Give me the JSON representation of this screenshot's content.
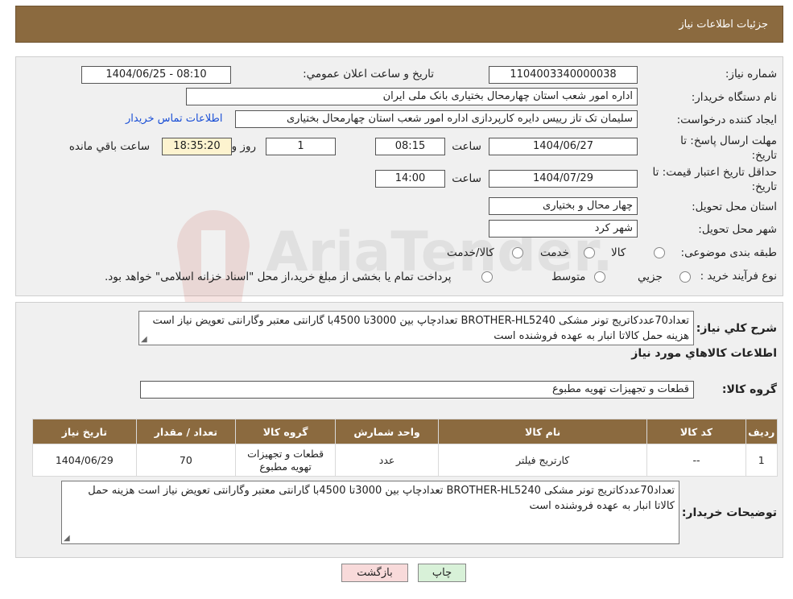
{
  "header": {
    "title": "جزئیات اطلاعات نیاز"
  },
  "form": {
    "need_number": {
      "label": "شماره نیاز:",
      "value": "1104003340000038"
    },
    "announce_datetime": {
      "label": "تاریخ و ساعت اعلان عمومي:",
      "value": "1404/06/25 - 08:10"
    },
    "buyer_org": {
      "label": "نام دستگاه خريدار:",
      "value": "اداره امور شعب استان چهارمحال بختیاری بانک ملی ایران"
    },
    "requester": {
      "label": "ايجاد كننده درخواست:",
      "value": "سلیمان تک تاز رییس دایره کارپردازی  اداره امور شعب استان چهارمحال بختیاری",
      "contact_link": "اطلاعات تماس خريدار"
    },
    "deadline": {
      "label": "مهلت ارسال پاسخ: تا تاريخ:",
      "date": "1404/06/27",
      "time_label": "ساعت",
      "time": "08:15",
      "days": "1",
      "days_label": "روز و",
      "remaining": "18:35:20",
      "remaining_label": "ساعت باقي مانده"
    },
    "price_validity": {
      "label": "حداقل تاريخ اعتبار قيمت: تا تاريخ:",
      "date": "1404/07/29",
      "time_label": "ساعت",
      "time": "14:00"
    },
    "delivery_province": {
      "label": "استان محل تحويل:",
      "value": "چهار محال و بختیاری"
    },
    "delivery_city": {
      "label": "شهر محل تحويل:",
      "value": "شهر کرد"
    },
    "category": {
      "label": "طبقه بندی موضوعی:",
      "options": [
        "کالا",
        "خدمت",
        "کالا/خدمت"
      ]
    },
    "purchase_type": {
      "label": "نوع فرآيند خريد :",
      "options": [
        "جزيي",
        "متوسط"
      ],
      "note": "پرداخت تمام یا بخشی از مبلغ خرید،از محل \"اسناد خزانه اسلامی\" خواهد بود."
    }
  },
  "summary": {
    "label": "شرح كلي نياز:",
    "text": "تعداد70عددکاتریج تونر مشکی BROTHER-HL5240 تعدادچاپ بین 3000تا 4500با گارانتی معتبر وگارانتی تعویض نیاز است هزینه حمل کالاتا انبار به عهده فروشنده است",
    "goods_info_title": "اطلاعات كالاهاي مورد نياز",
    "goods_group_label": "گروه كالا:",
    "goods_group_value": "قطعات و تجهیزات تهویه مطبوع"
  },
  "table": {
    "headers": [
      "رديف",
      "كد كالا",
      "نام كالا",
      "واحد شمارش",
      "گروه كالا",
      "تعداد / مقدار",
      "تاريخ نياز"
    ],
    "rows": [
      [
        "1",
        "--",
        "کارتریج فیلتر",
        "عدد",
        "قطعات و تجهیزات تهویه مطبوع",
        "70",
        "1404/06/29"
      ]
    ]
  },
  "buyer_notes": {
    "label": "توضيحات خريدار:",
    "text": "تعداد70عددکاتریج تونر مشکی BROTHER-HL5240 تعدادچاپ بین 3000تا 4500با گارانتی معتبر وگارانتی تعویض نیاز است هزینه حمل کالاتا انبار به عهده فروشنده است"
  },
  "buttons": {
    "print": "چاپ",
    "back": "بازگشت"
  },
  "watermark": {
    "text": "AriaTender.neT"
  },
  "colors": {
    "header_bg": "#8B6A3F",
    "back_button_bg": "#f8dada",
    "print_button_bg": "#d8f1d8",
    "link": "#1a4fd6"
  }
}
